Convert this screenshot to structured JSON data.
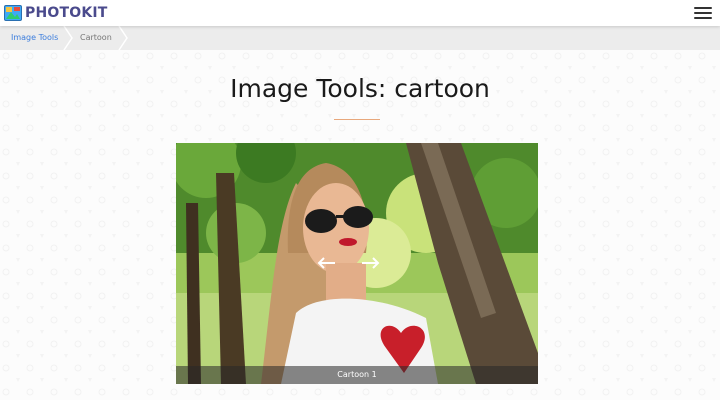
{
  "app": {
    "brand": "PHOTOKIT",
    "brand_color": "#4a4a8c",
    "accent_color": "#2f80ed"
  },
  "breadcrumb": {
    "items": [
      {
        "label": "Image Tools",
        "color": "#3b7ddd"
      },
      {
        "label": "Cartoon",
        "color": "#777777"
      }
    ]
  },
  "main": {
    "title": "Image Tools: cartoon",
    "divider_color": "#e8a87c"
  },
  "viewer": {
    "caption": "Cartoon 1",
    "prev_icon": "arrow-left-icon",
    "next_icon": "arrow-right-icon"
  },
  "icons": {
    "logo": "photokit-logo-icon",
    "menu": "hamburger-menu-icon",
    "breadcrumb_sep": "chevron-right-icon"
  }
}
